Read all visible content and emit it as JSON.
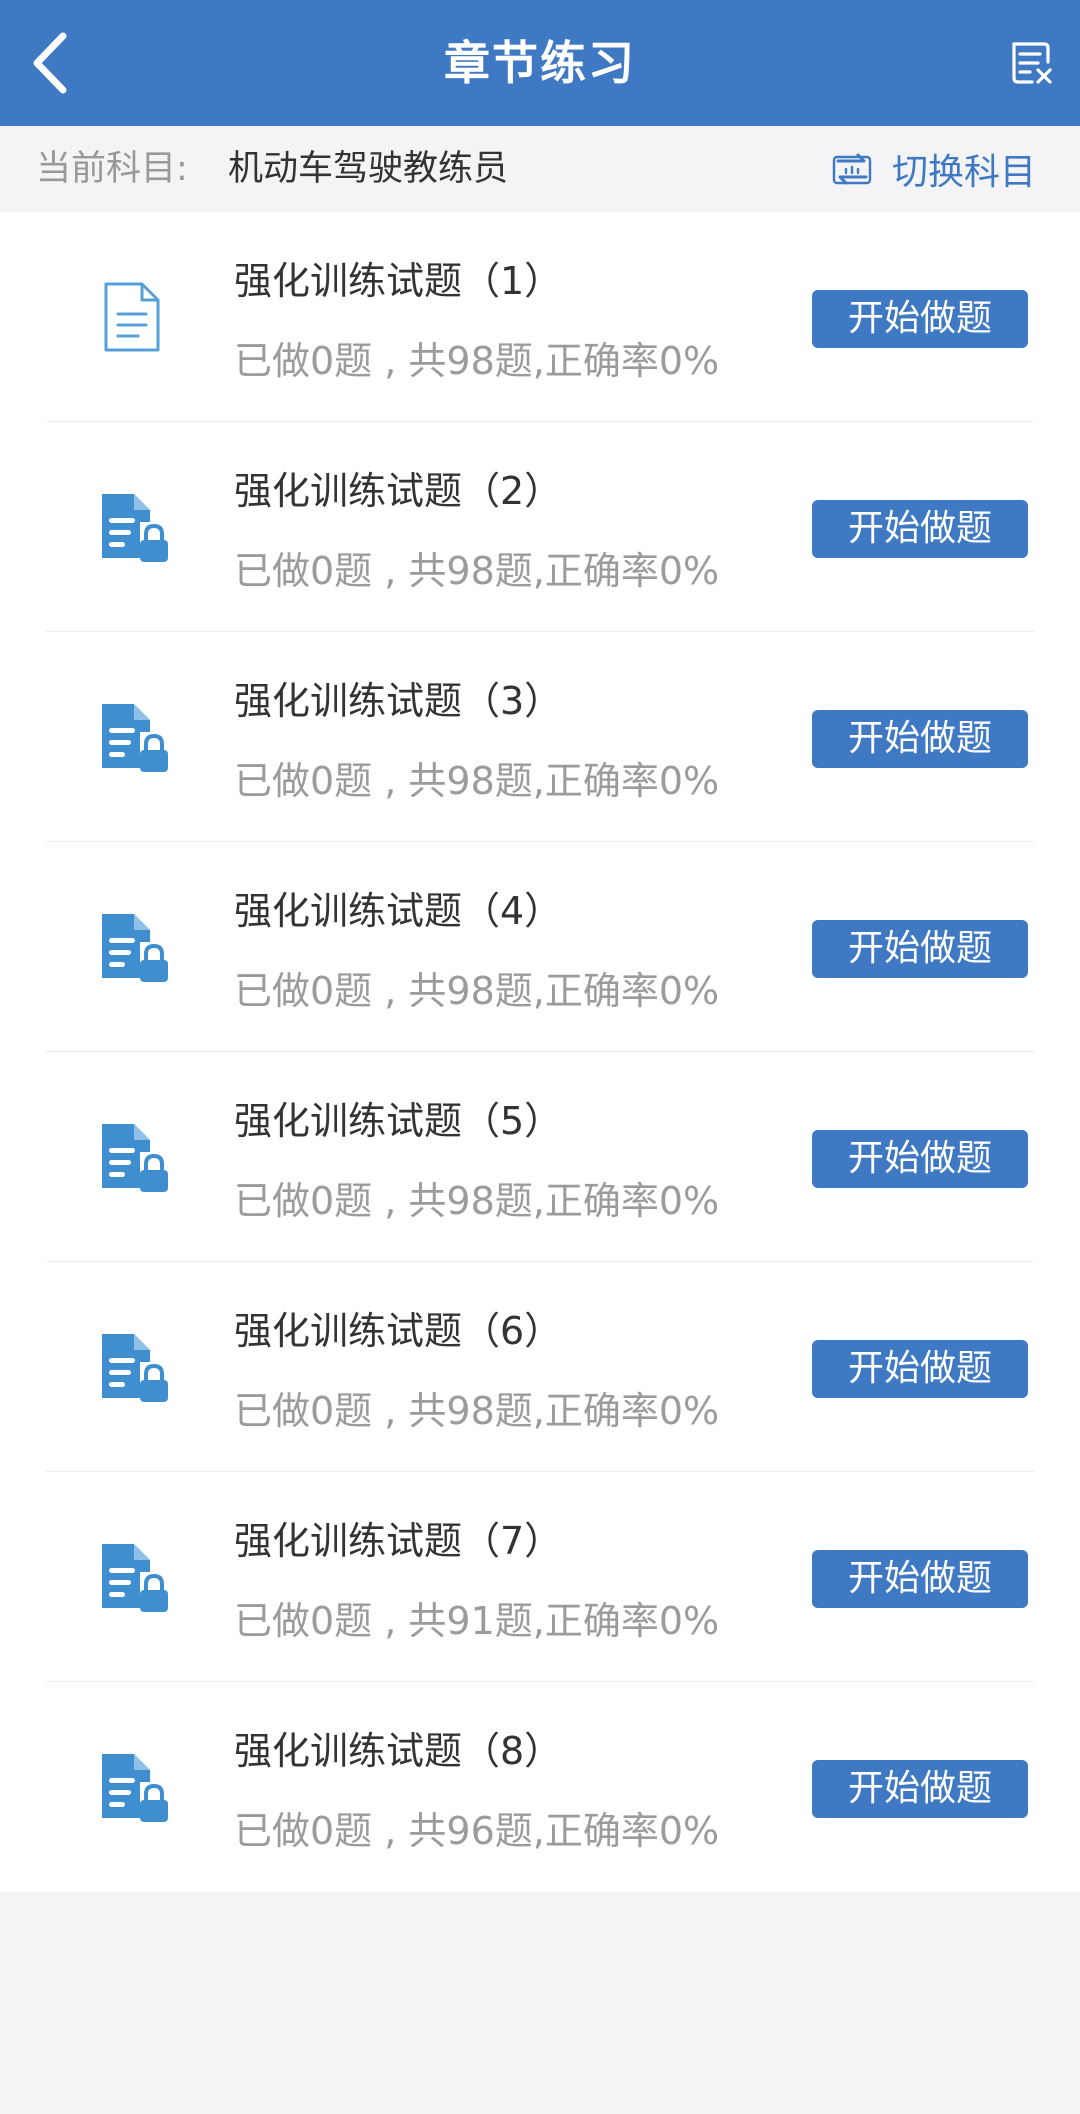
{
  "header": {
    "title": "章节练习",
    "back_icon": "chevron-left-icon",
    "clear_icon": "clear-records-icon",
    "background_color": "#3f79c3"
  },
  "subject": {
    "label": "当前科目:",
    "value": "机动车驾驶教练员",
    "switch_label": "切换科目",
    "switch_icon": "switch-subject-icon"
  },
  "exercises": [
    {
      "title": "强化训练试题（1）",
      "stats": "已做0题 , 共98题,正确率0%",
      "button": "开始做题",
      "icon": "document-icon",
      "locked": false
    },
    {
      "title": "强化训练试题（2）",
      "stats": "已做0题 , 共98题,正确率0%",
      "button": "开始做题",
      "icon": "locked-document-icon",
      "locked": true
    },
    {
      "title": "强化训练试题（3）",
      "stats": "已做0题 , 共98题,正确率0%",
      "button": "开始做题",
      "icon": "locked-document-icon",
      "locked": true
    },
    {
      "title": "强化训练试题（4）",
      "stats": "已做0题 , 共98题,正确率0%",
      "button": "开始做题",
      "icon": "locked-document-icon",
      "locked": true
    },
    {
      "title": "强化训练试题（5）",
      "stats": "已做0题 , 共98题,正确率0%",
      "button": "开始做题",
      "icon": "locked-document-icon",
      "locked": true
    },
    {
      "title": "强化训练试题（6）",
      "stats": "已做0题 , 共98题,正确率0%",
      "button": "开始做题",
      "icon": "locked-document-icon",
      "locked": true
    },
    {
      "title": "强化训练试题（7）",
      "stats": "已做0题 , 共91题,正确率0%",
      "button": "开始做题",
      "icon": "locked-document-icon",
      "locked": true
    },
    {
      "title": "强化训练试题（8）",
      "stats": "已做0题 , 共96题,正确率0%",
      "button": "开始做题",
      "icon": "locked-document-icon",
      "locked": true
    }
  ]
}
